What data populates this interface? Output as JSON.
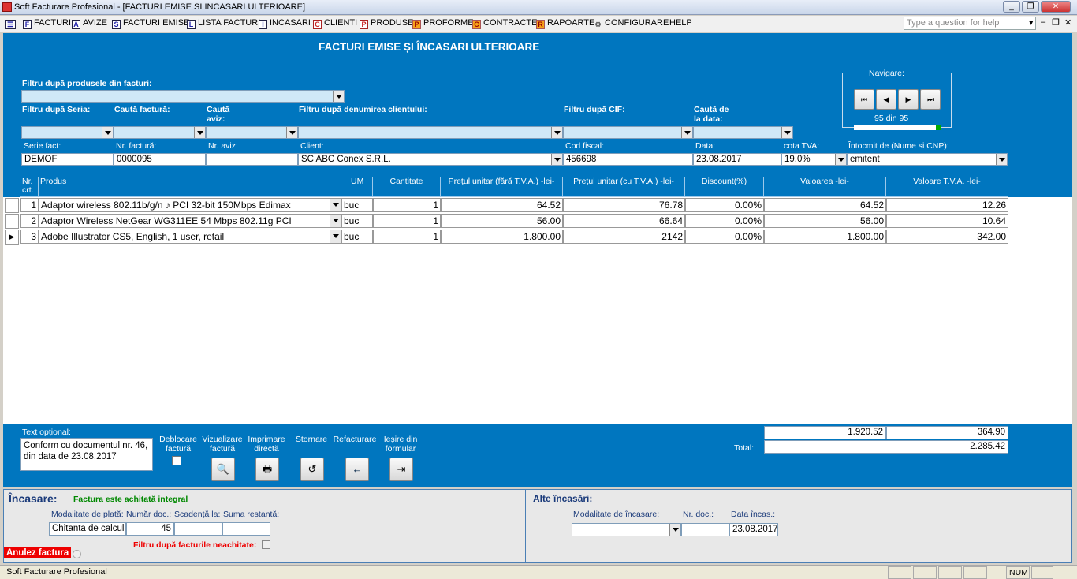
{
  "window": {
    "title": "Soft Facturare Profesional - [FACTURI EMISE SI INCASARI ULTERIOARE]",
    "min": "_",
    "max": "❐",
    "close": "✕"
  },
  "menu": {
    "items": [
      {
        "icon": "F",
        "label": "FACTURI"
      },
      {
        "icon": "A",
        "label": "AVIZE"
      },
      {
        "icon": "S",
        "label": "FACTURI EMISE"
      },
      {
        "icon": "L",
        "label": "LISTA FACTURI"
      },
      {
        "icon": "Î",
        "label": "INCASARI"
      },
      {
        "icon": "C",
        "label": "CLIENTI"
      },
      {
        "icon": "P",
        "label": "PRODUSE"
      },
      {
        "icon": "P",
        "label": "PROFORME"
      },
      {
        "icon": "C",
        "label": "CONTRACTE"
      },
      {
        "icon": "R",
        "label": "RAPOARTE"
      },
      {
        "icon": "⚙",
        "label": "CONFIGURARE"
      },
      {
        "icon": "",
        "label": "HELP"
      }
    ],
    "help_placeholder": "Type a question for help"
  },
  "form": {
    "title": "FACTURI EMISE ȘI ÎNCASARI ULTERIOARE",
    "filter_products_label": "Filtru după produsele din facturi:",
    "filter_series_label": "Filtru după Seria:",
    "search_invoice_label": "Caută factură:",
    "search_aviz_label1": "Caută",
    "search_aviz_label2": "aviz:",
    "filter_client_label": "Filtru după denumirea clientului:",
    "filter_cif_label": "Filtru după CIF:",
    "search_date_label1": "Caută de",
    "search_date_label2": "la data:",
    "nav": {
      "label": "Navigare:",
      "counter": "95  din  95",
      "first": "⏮",
      "prev": "◀",
      "next": "▶",
      "last": "⏭",
      "progress": 1.0
    },
    "fields": {
      "serie_label": "Serie fact:",
      "serie": "DEMOF",
      "nr_label": "Nr. factură:",
      "nr": "0000095",
      "aviz_label": "Nr. aviz:",
      "aviz": "",
      "client_label": "Client:",
      "client": "SC ABC Conex S.R.L.",
      "cif_label": "Cod fiscal:",
      "cif": "456698",
      "date_label": "Data:",
      "date": "23.08.2017",
      "tva_label": "cota TVA:",
      "tva": "19.0%",
      "author_label": "Întocmit de (Nume si CNP):",
      "author": "emitent"
    },
    "table": {
      "headers": [
        "Nr. crt.",
        "Produs",
        "UM",
        "Cantitate",
        "Prețul unitar (fără T.V.A.) -lei-",
        "Prețul unitar (cu T.V.A.) -lei-",
        "Discount(%)",
        "Valoarea -lei-",
        "Valoare T.V.A. -lei-"
      ],
      "rows": [
        {
          "nr": "1",
          "produs": "Adaptor wireless 802.11b/g/n ♪ PCI 32-bit 150Mbps Edimax",
          "um": "buc",
          "cant": "1",
          "pu": "64.52",
          "puc": "76.78",
          "disc": "0.00%",
          "val": "64.52",
          "tva": "12.26"
        },
        {
          "nr": "2",
          "produs": "Adaptor Wireless NetGear WG311EE 54 Mbps 802.11g PCI",
          "um": "buc",
          "cant": "1",
          "pu": "56.00",
          "puc": "66.64",
          "disc": "0.00%",
          "val": "56.00",
          "tva": "10.64"
        },
        {
          "nr": "3",
          "produs": "Adobe Illustrator CS5, English, 1 user, retail",
          "um": "buc",
          "cant": "1",
          "pu": "1.800.00",
          "puc": "2142",
          "disc": "0.00%",
          "val": "1.800.00",
          "tva": "342.00"
        }
      ]
    },
    "footer": {
      "text_label": "Text opțional:",
      "text_value": "Conform cu documentul nr. 46, din data de 23.08.2017",
      "deblocare1": "Deblocare",
      "deblocare2": "factură",
      "viz1": "Vizualizare",
      "viz2": "factură",
      "imp1": "Imprimare",
      "imp2": "directă",
      "storn": "Stornare",
      "refact": "Refacturare",
      "iesire1": "Ieșire din",
      "iesire2": "formular",
      "sum_val": "1.920.52",
      "sum_tva": "364.90",
      "total_label": "Total:",
      "total": "2.285.42"
    }
  },
  "incasare": {
    "title": "Încasare:",
    "status": "Factura este achitată integral",
    "mod_label": "Modalitate de plată:",
    "nr_label": "Număr doc.:",
    "scad_label": "Scadență la:",
    "rest_label": "Suma restantă:",
    "mod": "Chitanta de calcul",
    "nr": "45",
    "scad": "",
    "rest": "",
    "filter_label": "Filtru după facturile neachitate:",
    "anulez": "Anulez factura"
  },
  "alte": {
    "title": "Alte încasări:",
    "mod_label": "Modalitate de încasare:",
    "nr_label": "Nr. doc.:",
    "date_label": "Data încas.:",
    "mod": "",
    "nr": "",
    "date": "23.08.2017"
  },
  "status": {
    "text": "Soft Facturare Profesional",
    "num": "NUM"
  }
}
